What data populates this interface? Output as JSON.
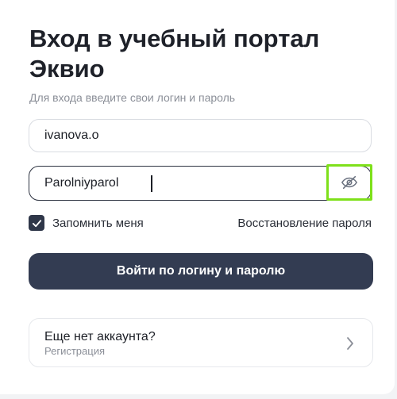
{
  "header": {
    "title": "Вход в учебный портал Эквио",
    "subtitle": "Для входа введите свои логин и пароль"
  },
  "form": {
    "login_value": "ivanova.o",
    "password_value": "Parolniyparol",
    "toggle_icon": "eye-off-icon",
    "remember_label": "Запомнить меня",
    "remember_checked": true,
    "restore_label": "Восстановление пароля",
    "submit_label": "Войти по логину и паролю"
  },
  "register": {
    "question": "Еще нет аккаунта?",
    "link": "Регистрация"
  },
  "colors": {
    "primary": "#333c52",
    "highlight": "#7ee01a"
  }
}
